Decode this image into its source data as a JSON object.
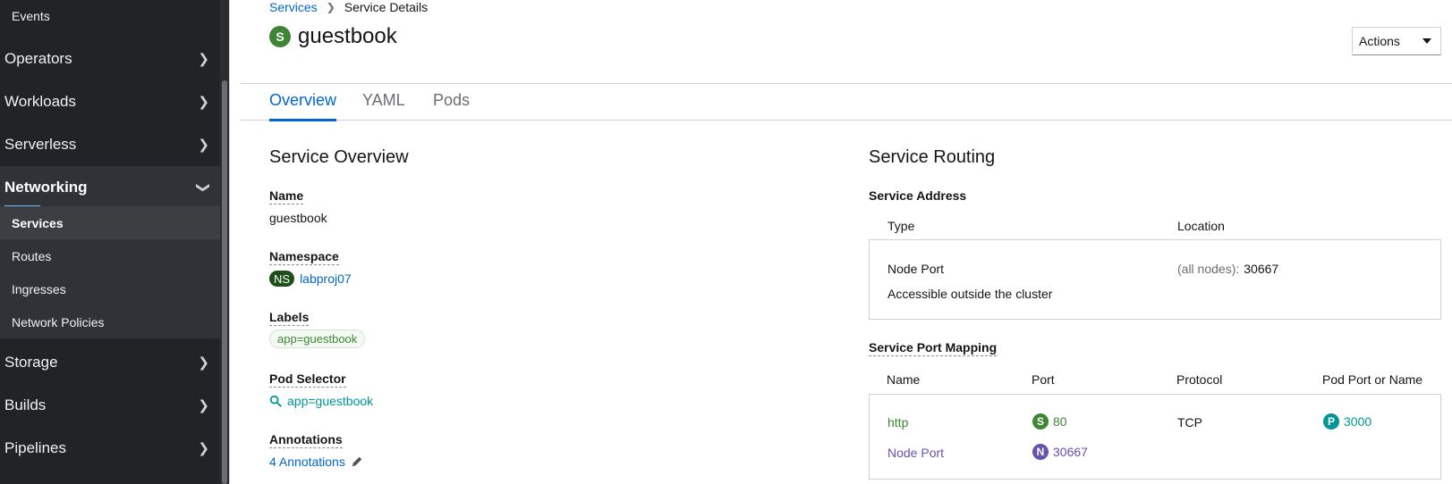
{
  "sidebar": {
    "events_label": "Events",
    "groups": [
      {
        "label": "Operators"
      },
      {
        "label": "Workloads"
      },
      {
        "label": "Serverless"
      },
      {
        "label": "Networking"
      },
      {
        "label": "Storage"
      },
      {
        "label": "Builds"
      },
      {
        "label": "Pipelines"
      }
    ],
    "networking_items": [
      {
        "label": "Services"
      },
      {
        "label": "Routes"
      },
      {
        "label": "Ingresses"
      },
      {
        "label": "Network Policies"
      }
    ]
  },
  "breadcrumb": {
    "parent": "Services",
    "current": "Service Details"
  },
  "header": {
    "badge": "S",
    "title": "guestbook",
    "actions_label": "Actions"
  },
  "tabs": [
    {
      "label": "Overview",
      "active": true
    },
    {
      "label": "YAML"
    },
    {
      "label": "Pods"
    }
  ],
  "overview": {
    "title": "Service Overview",
    "name_label": "Name",
    "name_value": "guestbook",
    "namespace_label": "Namespace",
    "namespace_badge": "NS",
    "namespace_value": "labproj07",
    "labels_label": "Labels",
    "labels_value": "app=guestbook",
    "pod_selector_label": "Pod Selector",
    "pod_selector_value": "app=guestbook",
    "annotations_label": "Annotations",
    "annotations_value": "4 Annotations"
  },
  "routing": {
    "title": "Service Routing",
    "address_label": "Service Address",
    "address_columns": [
      "Type",
      "Location"
    ],
    "address_row": {
      "type": "Node Port",
      "description": "Accessible outside the cluster",
      "location_prefix": "(all nodes):",
      "location_value": "30667"
    },
    "port_mapping_label": "Service Port Mapping",
    "port_columns": [
      "Name",
      "Port",
      "Protocol",
      "Pod Port or Name"
    ],
    "port_row": {
      "name": "http",
      "port_badge": "S",
      "port": "80",
      "protocol": "TCP",
      "pod_port_badge": "P",
      "pod_port": "3000",
      "nodeport_name": "Node Port",
      "nodeport_badge": "N",
      "nodeport": "30667"
    }
  },
  "colors": {
    "sidebar_bg": "#212427",
    "link": "#0066cc",
    "service_badge": "#3e8635",
    "nodeport_purple": "#6753ac",
    "pod_teal": "#009596"
  }
}
